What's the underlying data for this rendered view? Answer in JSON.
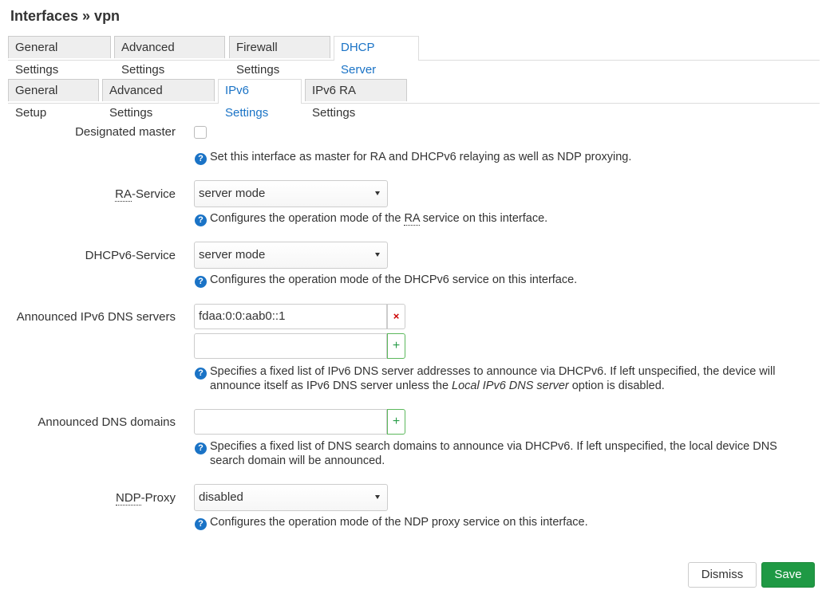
{
  "page": {
    "title": "Interfaces » vpn"
  },
  "tabs": [
    {
      "label": "General Settings"
    },
    {
      "label": "Advanced Settings"
    },
    {
      "label": "Firewall Settings"
    },
    {
      "label": "DHCP Server"
    }
  ],
  "subtabs": [
    {
      "label": "General Setup"
    },
    {
      "label": "Advanced Settings"
    },
    {
      "label": "IPv6 Settings"
    },
    {
      "label": "IPv6 RA Settings"
    }
  ],
  "fields": {
    "designated_master": {
      "label": "Designated master",
      "checked": false,
      "help": "Set this interface as master for RA and DHCPv6 relaying as well as NDP proxying."
    },
    "ra_service": {
      "label_abbr": "RA",
      "label_rest": "-Service",
      "value": "server mode",
      "help_pre": "Configures the operation mode of the ",
      "help_abbr": "RA",
      "help_post": " service on this interface."
    },
    "dhcpv6_service": {
      "label": "DHCPv6-Service",
      "value": "server mode",
      "help": "Configures the operation mode of the DHCPv6 service on this interface."
    },
    "dns_servers": {
      "label": "Announced IPv6 DNS servers",
      "entries": [
        "fdaa:0:0:aab0::1"
      ],
      "new_value": "",
      "remove_symbol": "×",
      "add_symbol": "+",
      "help_pre": "Specifies a fixed list of IPv6 DNS server addresses to announce via DHCPv6. If left unspecified, the device will announce itself as IPv6 DNS server unless the ",
      "help_em": "Local IPv6 DNS server",
      "help_post": " option is disabled."
    },
    "dns_domains": {
      "label": "Announced DNS domains",
      "new_value": "",
      "add_symbol": "+",
      "help": "Specifies a fixed list of DNS search domains to announce via DHCPv6. If left unspecified, the local device DNS search domain will be announced."
    },
    "ndp_proxy": {
      "label_abbr": "NDP",
      "label_rest": "-Proxy",
      "value": "disabled",
      "help": "Configures the operation mode of the NDP proxy service on this interface."
    }
  },
  "help_symbol": "?",
  "buttons": {
    "dismiss": "Dismiss",
    "save": "Save"
  }
}
